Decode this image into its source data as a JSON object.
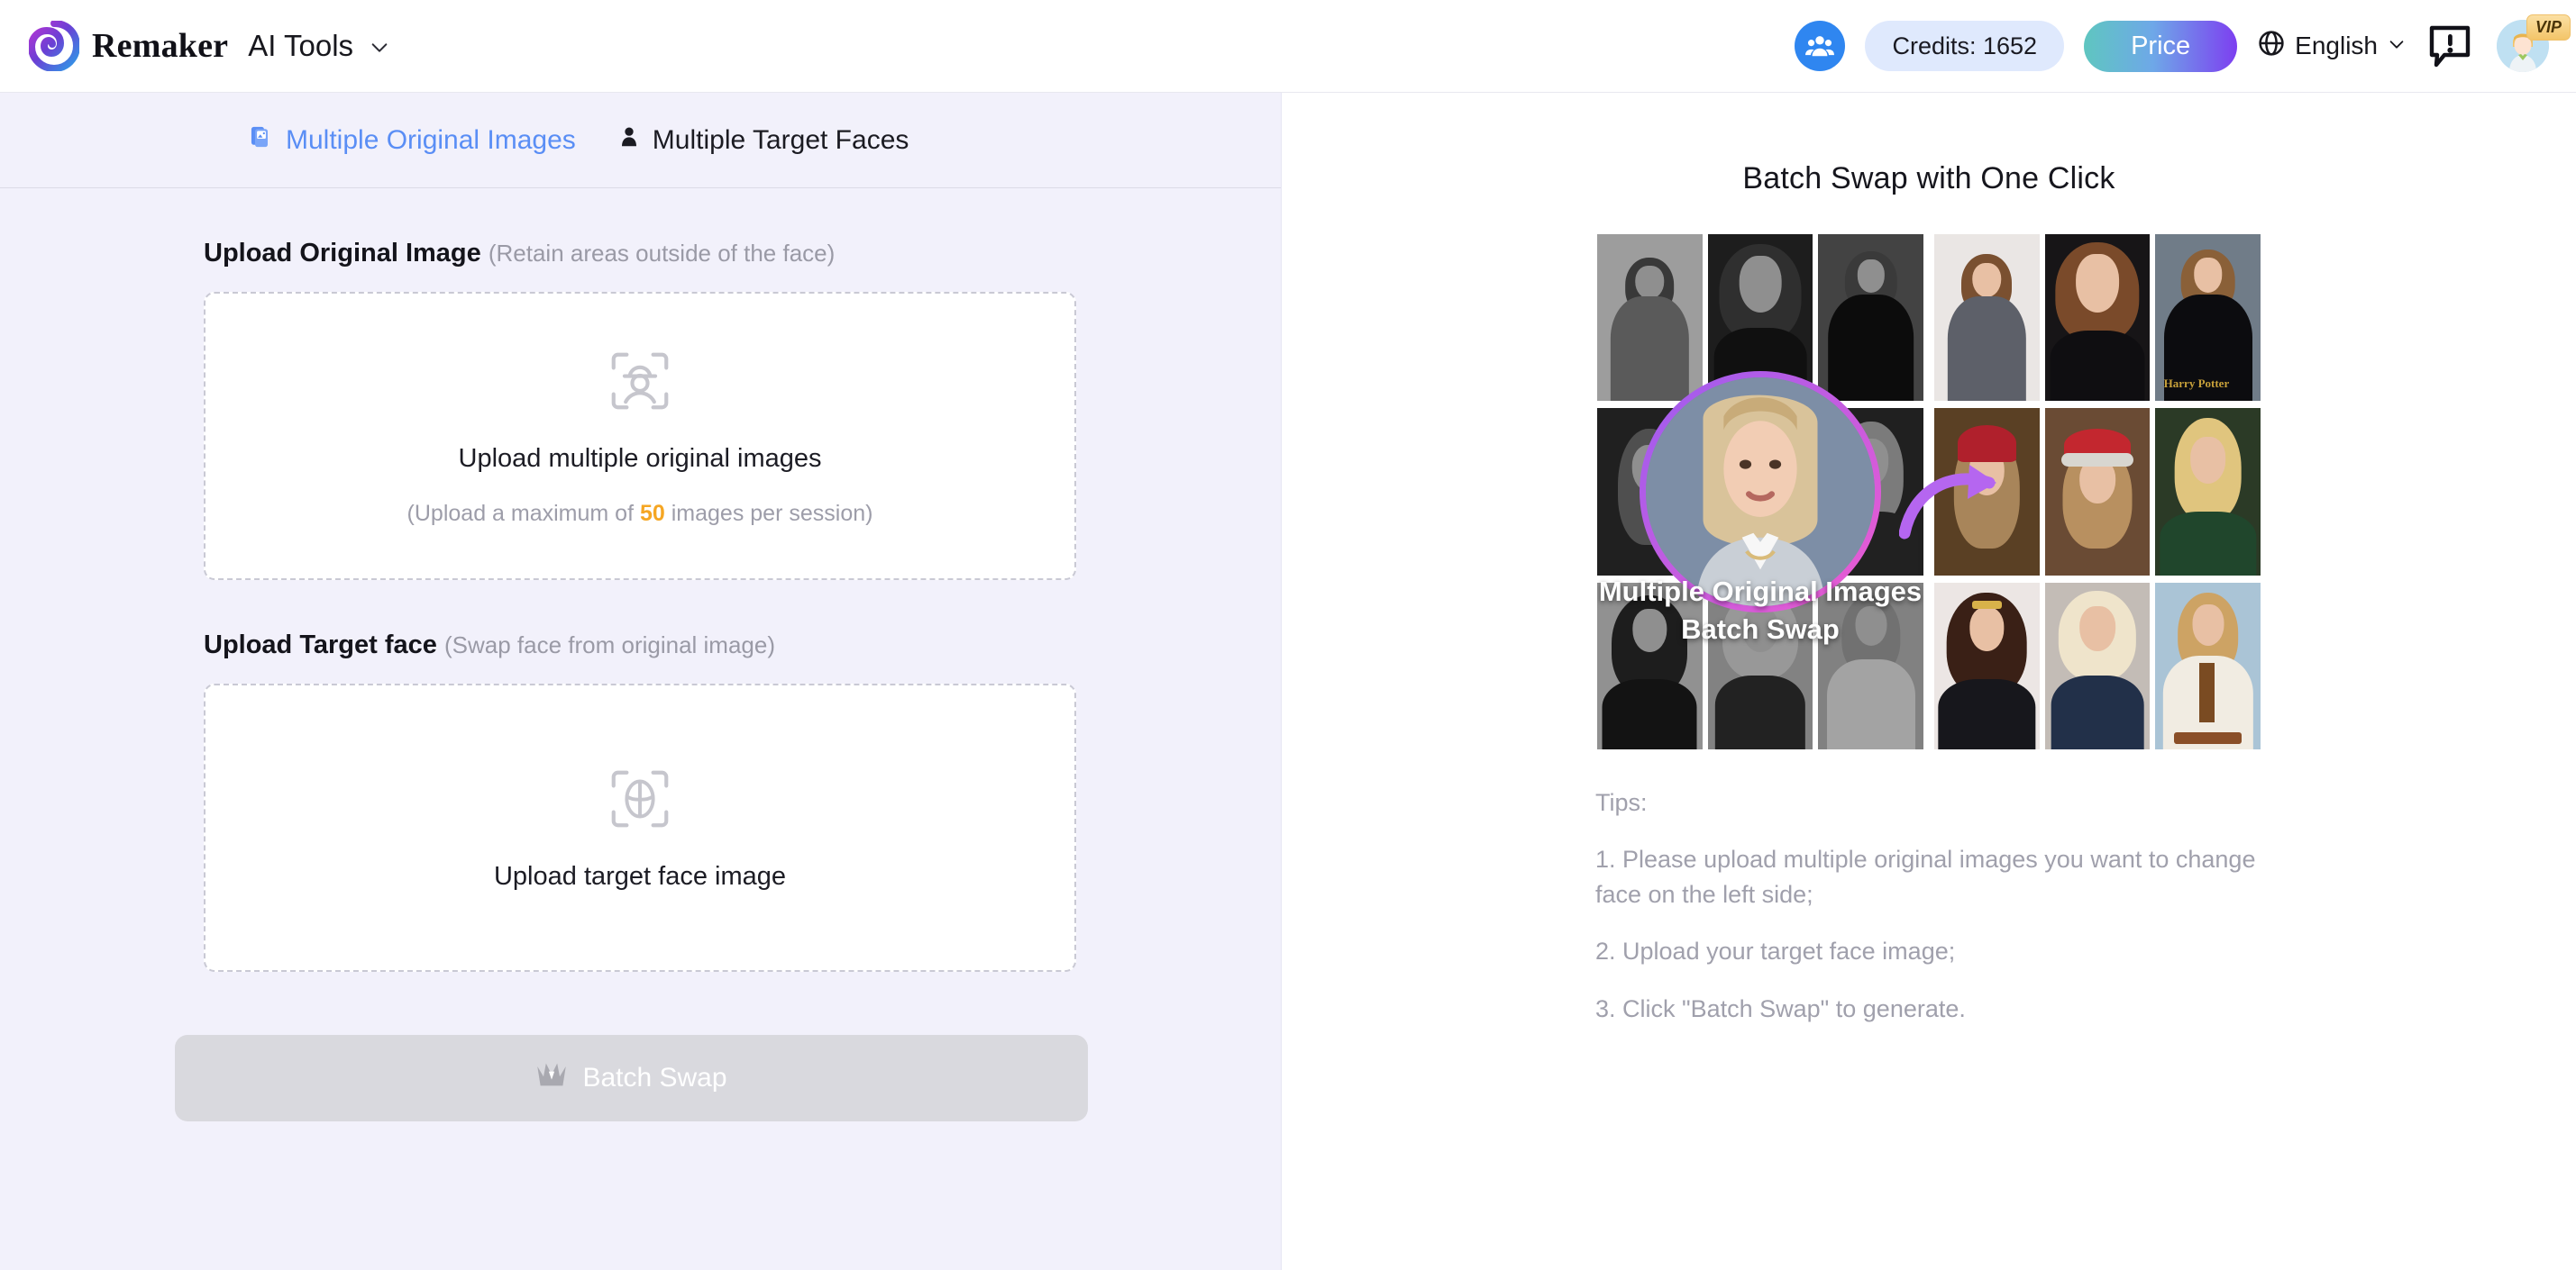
{
  "header": {
    "brand_name": "Remaker",
    "nav_label": "AI Tools",
    "chevron_icon": "chevron-down-icon",
    "group_icon": "group-people-icon",
    "credits_label": "Credits: 1652",
    "price_label": "Price",
    "globe_icon": "globe-icon",
    "language": "English",
    "language_chevron_icon": "chevron-down-icon",
    "feedback_icon": "feedback-exclamation-icon",
    "avatar_icon": "user-avatar",
    "vip_badge": "VIP",
    "price_gradient_from": "#5fc6c0",
    "price_gradient_to": "#7d3ff0",
    "credits_bg": "#dfe9fd"
  },
  "tabs": [
    {
      "label": "Multiple Original Images",
      "icon": "stacked-images-icon",
      "active": true,
      "color": "#5a8ef5"
    },
    {
      "label": "Multiple Target Faces",
      "icon": "person-icon",
      "active": false,
      "color": "#1b1b22"
    }
  ],
  "form": {
    "original": {
      "title": "Upload Original Image",
      "subtitle": "(Retain areas outside of the face)",
      "icon": "scan-person-hat-icon",
      "main_text": "Upload multiple original images",
      "hint_prefix": "(Upload a maximum of ",
      "hint_number": "50",
      "hint_suffix": " images per session)",
      "hint_number_color": "#f5a623"
    },
    "target": {
      "title": "Upload Target face",
      "subtitle": "(Swap face from original image)",
      "icon": "scan-face-crosshair-icon",
      "main_text": "Upload target face image"
    },
    "submit": {
      "label": "Batch Swap",
      "icon": "crown-icon",
      "disabled": true,
      "bg": "#d9d9de"
    }
  },
  "promo": {
    "title": "Batch Swap with One Click",
    "overlay_caption_line1": "Multiple Original Images",
    "overlay_caption_line2": "Batch Swap",
    "target_ring_from": "#9b5cf0",
    "target_ring_to": "#ef5bd0",
    "arrow_icon": "curved-arrow-right-icon",
    "watermark": "Harry Potter",
    "before_label": "before-collage",
    "after_label": "after-collage"
  },
  "tips": {
    "heading": "Tips:",
    "items": [
      "1. Please upload multiple original images you want to change face on the left side;",
      "2. Upload your target face image;",
      "3. Click \"Batch Swap\" to generate."
    ]
  }
}
